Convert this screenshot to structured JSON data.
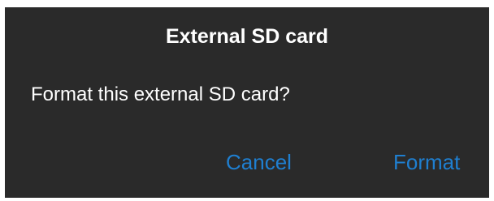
{
  "dialog": {
    "title": "External SD card",
    "message": "Format this external SD card?",
    "cancel_label": "Cancel",
    "format_label": "Format"
  },
  "colors": {
    "dialog_background": "#2a2a2a",
    "text": "#ffffff",
    "accent": "#1f7fd0"
  }
}
